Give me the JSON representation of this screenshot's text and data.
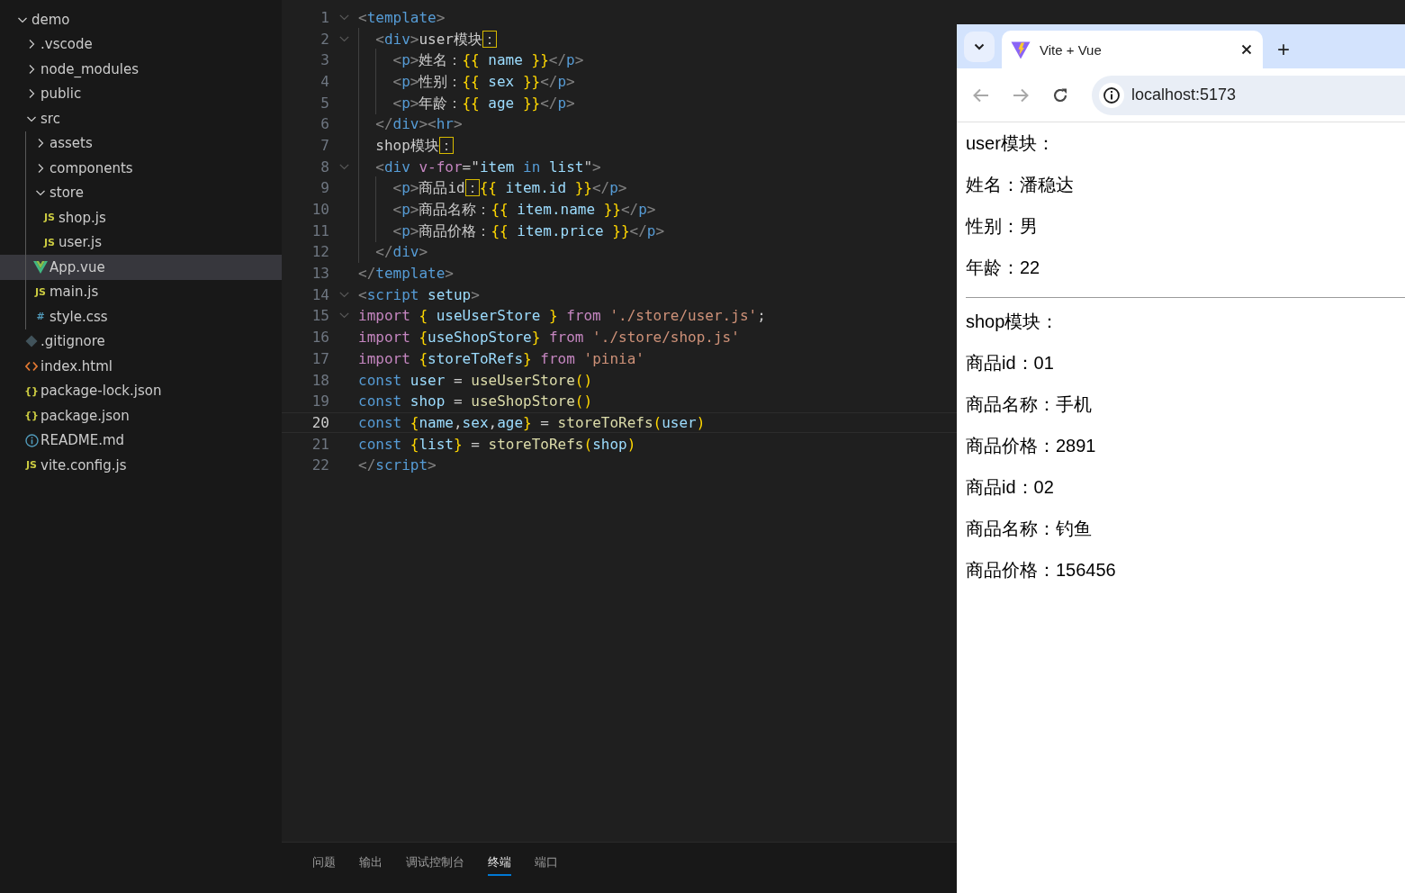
{
  "explorer": {
    "tree": [
      {
        "name": "demo",
        "kind": "folder",
        "expanded": true,
        "selected": false,
        "children": [
          {
            "name": ".vscode",
            "kind": "folder",
            "expanded": false,
            "selected": false
          },
          {
            "name": "node_modules",
            "kind": "folder",
            "expanded": false,
            "selected": false
          },
          {
            "name": "public",
            "kind": "folder",
            "expanded": false,
            "selected": false
          },
          {
            "name": "src",
            "kind": "folder",
            "expanded": true,
            "selected": false,
            "children": [
              {
                "name": "assets",
                "kind": "folder",
                "expanded": false,
                "selected": false
              },
              {
                "name": "components",
                "kind": "folder",
                "expanded": false,
                "selected": false
              },
              {
                "name": "store",
                "kind": "folder",
                "expanded": true,
                "selected": false,
                "children": [
                  {
                    "name": "shop.js",
                    "kind": "js",
                    "icon_text": "JS",
                    "selected": false
                  },
                  {
                    "name": "user.js",
                    "kind": "js",
                    "icon_text": "JS",
                    "selected": false
                  }
                ]
              },
              {
                "name": "App.vue",
                "kind": "vue",
                "selected": true
              },
              {
                "name": "main.js",
                "kind": "js",
                "icon_text": "JS",
                "selected": false
              },
              {
                "name": "style.css",
                "kind": "css",
                "icon_text": "#",
                "selected": false
              }
            ]
          },
          {
            "name": ".gitignore",
            "kind": "git",
            "selected": false
          },
          {
            "name": "index.html",
            "kind": "html",
            "selected": false
          },
          {
            "name": "package-lock.json",
            "kind": "json",
            "icon_text": "{}",
            "selected": false
          },
          {
            "name": "package.json",
            "kind": "json",
            "icon_text": "{}",
            "selected": false
          },
          {
            "name": "README.md",
            "kind": "info",
            "selected": false
          },
          {
            "name": "vite.config.js",
            "kind": "js",
            "icon_text": "JS",
            "selected": false
          }
        ]
      }
    ]
  },
  "editor": {
    "lines": [
      {
        "number": "1",
        "fold": true,
        "active": false,
        "tokens": [
          {
            "kind": "punct",
            "text": "<"
          },
          {
            "kind": "tag",
            "text": "template"
          },
          {
            "kind": "punct",
            "text": ">"
          }
        ]
      },
      {
        "number": "2",
        "fold": true,
        "active": false,
        "tokens": [
          {
            "kind": "punct",
            "text": "  <"
          },
          {
            "kind": "tag",
            "text": "div"
          },
          {
            "kind": "punct",
            "text": ">"
          },
          {
            "kind": "text",
            "text": "user模块"
          },
          {
            "kind": "boxed",
            "text": "："
          }
        ]
      },
      {
        "number": "3",
        "fold": false,
        "active": false,
        "tokens": [
          {
            "kind": "punct",
            "text": "    <"
          },
          {
            "kind": "tag",
            "text": "p"
          },
          {
            "kind": "punct",
            "text": ">"
          },
          {
            "kind": "text",
            "text": "姓名："
          },
          {
            "kind": "brace",
            "text": "{{"
          },
          {
            "kind": "variable",
            "text": " name "
          },
          {
            "kind": "brace",
            "text": "}}"
          },
          {
            "kind": "punct",
            "text": "</"
          },
          {
            "kind": "tag",
            "text": "p"
          },
          {
            "kind": "punct",
            "text": ">"
          }
        ]
      },
      {
        "number": "4",
        "fold": false,
        "active": false,
        "tokens": [
          {
            "kind": "punct",
            "text": "    <"
          },
          {
            "kind": "tag",
            "text": "p"
          },
          {
            "kind": "punct",
            "text": ">"
          },
          {
            "kind": "text",
            "text": "性别："
          },
          {
            "kind": "brace",
            "text": "{{"
          },
          {
            "kind": "variable",
            "text": " sex "
          },
          {
            "kind": "brace",
            "text": "}}"
          },
          {
            "kind": "punct",
            "text": "</"
          },
          {
            "kind": "tag",
            "text": "p"
          },
          {
            "kind": "punct",
            "text": ">"
          }
        ]
      },
      {
        "number": "5",
        "fold": false,
        "active": false,
        "tokens": [
          {
            "kind": "punct",
            "text": "    <"
          },
          {
            "kind": "tag",
            "text": "p"
          },
          {
            "kind": "punct",
            "text": ">"
          },
          {
            "kind": "text",
            "text": "年龄："
          },
          {
            "kind": "brace",
            "text": "{{"
          },
          {
            "kind": "variable",
            "text": " age "
          },
          {
            "kind": "brace",
            "text": "}}"
          },
          {
            "kind": "punct",
            "text": "</"
          },
          {
            "kind": "tag",
            "text": "p"
          },
          {
            "kind": "punct",
            "text": ">"
          }
        ]
      },
      {
        "number": "6",
        "fold": false,
        "active": false,
        "tokens": [
          {
            "kind": "punct",
            "text": "  </"
          },
          {
            "kind": "tag",
            "text": "div"
          },
          {
            "kind": "punct",
            "text": "><"
          },
          {
            "kind": "tag",
            "text": "hr"
          },
          {
            "kind": "punct",
            "text": ">"
          }
        ]
      },
      {
        "number": "7",
        "fold": false,
        "active": false,
        "tokens": [
          {
            "kind": "text",
            "text": "  shop模块"
          },
          {
            "kind": "boxed",
            "text": "："
          }
        ]
      },
      {
        "number": "8",
        "fold": true,
        "active": false,
        "tokens": [
          {
            "kind": "punct",
            "text": "  <"
          },
          {
            "kind": "tag",
            "text": "div"
          },
          {
            "kind": "keyword",
            "text": " v-for"
          },
          {
            "kind": "text",
            "text": "=\""
          },
          {
            "kind": "variable",
            "text": "item"
          },
          {
            "kind": "storage",
            "text": " in "
          },
          {
            "kind": "variable",
            "text": "list"
          },
          {
            "kind": "text",
            "text": "\""
          },
          {
            "kind": "punct",
            "text": ">"
          }
        ]
      },
      {
        "number": "9",
        "fold": false,
        "active": false,
        "tokens": [
          {
            "kind": "punct",
            "text": "    <"
          },
          {
            "kind": "tag",
            "text": "p"
          },
          {
            "kind": "punct",
            "text": ">"
          },
          {
            "kind": "text",
            "text": "商品id"
          },
          {
            "kind": "boxed",
            "text": "："
          },
          {
            "kind": "brace",
            "text": "{{"
          },
          {
            "kind": "variable",
            "text": " item.id "
          },
          {
            "kind": "brace",
            "text": "}}"
          },
          {
            "kind": "punct",
            "text": "</"
          },
          {
            "kind": "tag",
            "text": "p"
          },
          {
            "kind": "punct",
            "text": ">"
          }
        ]
      },
      {
        "number": "10",
        "fold": false,
        "active": false,
        "tokens": [
          {
            "kind": "punct",
            "text": "    <"
          },
          {
            "kind": "tag",
            "text": "p"
          },
          {
            "kind": "punct",
            "text": ">"
          },
          {
            "kind": "text",
            "text": "商品名称："
          },
          {
            "kind": "brace",
            "text": "{{"
          },
          {
            "kind": "variable",
            "text": " item.name "
          },
          {
            "kind": "brace",
            "text": "}}"
          },
          {
            "kind": "punct",
            "text": "</"
          },
          {
            "kind": "tag",
            "text": "p"
          },
          {
            "kind": "punct",
            "text": ">"
          }
        ]
      },
      {
        "number": "11",
        "fold": false,
        "active": false,
        "tokens": [
          {
            "kind": "punct",
            "text": "    <"
          },
          {
            "kind": "tag",
            "text": "p"
          },
          {
            "kind": "punct",
            "text": ">"
          },
          {
            "kind": "text",
            "text": "商品价格："
          },
          {
            "kind": "brace",
            "text": "{{"
          },
          {
            "kind": "variable",
            "text": " item.price "
          },
          {
            "kind": "brace",
            "text": "}}"
          },
          {
            "kind": "punct",
            "text": "</"
          },
          {
            "kind": "tag",
            "text": "p"
          },
          {
            "kind": "punct",
            "text": ">"
          }
        ]
      },
      {
        "number": "12",
        "fold": false,
        "active": false,
        "tokens": [
          {
            "kind": "punct",
            "text": "  </"
          },
          {
            "kind": "tag",
            "text": "div"
          },
          {
            "kind": "punct",
            "text": ">"
          }
        ]
      },
      {
        "number": "13",
        "fold": false,
        "active": false,
        "tokens": [
          {
            "kind": "punct",
            "text": "</"
          },
          {
            "kind": "tag",
            "text": "template"
          },
          {
            "kind": "punct",
            "text": ">"
          }
        ]
      },
      {
        "number": "14",
        "fold": true,
        "active": false,
        "tokens": [
          {
            "kind": "punct",
            "text": "<"
          },
          {
            "kind": "tag",
            "text": "script"
          },
          {
            "kind": "variable",
            "text": " setup"
          },
          {
            "kind": "punct",
            "text": ">"
          }
        ]
      },
      {
        "number": "15",
        "fold": true,
        "active": false,
        "tokens": [
          {
            "kind": "keyword",
            "text": "import "
          },
          {
            "kind": "brace",
            "text": "{"
          },
          {
            "kind": "variable",
            "text": " useUserStore "
          },
          {
            "kind": "brace",
            "text": "}"
          },
          {
            "kind": "keyword",
            "text": " from"
          },
          {
            "kind": "string",
            "text": " './store/user.js'"
          },
          {
            "kind": "text",
            "text": ";"
          }
        ]
      },
      {
        "number": "16",
        "fold": false,
        "active": false,
        "tokens": [
          {
            "kind": "keyword",
            "text": "import "
          },
          {
            "kind": "brace",
            "text": "{"
          },
          {
            "kind": "variable",
            "text": "useShopStore"
          },
          {
            "kind": "brace",
            "text": "}"
          },
          {
            "kind": "keyword",
            "text": " from"
          },
          {
            "kind": "string",
            "text": " './store/shop.js'"
          }
        ]
      },
      {
        "number": "17",
        "fold": false,
        "active": false,
        "tokens": [
          {
            "kind": "keyword",
            "text": "import "
          },
          {
            "kind": "brace",
            "text": "{"
          },
          {
            "kind": "variable",
            "text": "storeToRefs"
          },
          {
            "kind": "brace",
            "text": "}"
          },
          {
            "kind": "keyword",
            "text": " from"
          },
          {
            "kind": "string",
            "text": " 'pinia'"
          }
        ]
      },
      {
        "number": "18",
        "fold": false,
        "active": false,
        "tokens": [
          {
            "kind": "storage",
            "text": "const"
          },
          {
            "kind": "variable",
            "text": " user"
          },
          {
            "kind": "text",
            "text": " = "
          },
          {
            "kind": "function",
            "text": "useUserStore"
          },
          {
            "kind": "brace",
            "text": "()"
          }
        ]
      },
      {
        "number": "19",
        "fold": false,
        "active": false,
        "tokens": [
          {
            "kind": "storage",
            "text": "const"
          },
          {
            "kind": "variable",
            "text": " shop"
          },
          {
            "kind": "text",
            "text": " = "
          },
          {
            "kind": "function",
            "text": "useShopStore"
          },
          {
            "kind": "brace",
            "text": "()"
          }
        ]
      },
      {
        "number": "20",
        "fold": false,
        "active": true,
        "tokens": [
          {
            "kind": "storage",
            "text": "const "
          },
          {
            "kind": "brace",
            "text": "{"
          },
          {
            "kind": "variable",
            "text": "name"
          },
          {
            "kind": "text",
            "text": ","
          },
          {
            "kind": "variable",
            "text": "sex"
          },
          {
            "kind": "text",
            "text": ","
          },
          {
            "kind": "variable",
            "text": "age"
          },
          {
            "kind": "brace",
            "text": "}"
          },
          {
            "kind": "text",
            "text": " = "
          },
          {
            "kind": "function",
            "text": "storeToRefs"
          },
          {
            "kind": "brace",
            "text": "("
          },
          {
            "kind": "variable",
            "text": "user"
          },
          {
            "kind": "brace",
            "text": ")"
          }
        ]
      },
      {
        "number": "21",
        "fold": false,
        "active": false,
        "tokens": [
          {
            "kind": "storage",
            "text": "const "
          },
          {
            "kind": "brace",
            "text": "{"
          },
          {
            "kind": "variable",
            "text": "list"
          },
          {
            "kind": "brace",
            "text": "}"
          },
          {
            "kind": "text",
            "text": " = "
          },
          {
            "kind": "function",
            "text": "storeToRefs"
          },
          {
            "kind": "brace",
            "text": "("
          },
          {
            "kind": "variable",
            "text": "shop"
          },
          {
            "kind": "brace",
            "text": ")"
          }
        ]
      },
      {
        "number": "22",
        "fold": false,
        "active": false,
        "tokens": [
          {
            "kind": "punct",
            "text": "</"
          },
          {
            "kind": "tag",
            "text": "script"
          },
          {
            "kind": "punct",
            "text": ">"
          }
        ]
      }
    ]
  },
  "panel": {
    "tabs": [
      {
        "label": "问题",
        "selected": false
      },
      {
        "label": "输出",
        "selected": false
      },
      {
        "label": "调试控制台",
        "selected": false
      },
      {
        "label": "终端",
        "selected": true
      },
      {
        "label": "端口",
        "selected": false
      }
    ]
  },
  "browser": {
    "tab": {
      "title": "Vite + Vue"
    },
    "new_tab": "+",
    "back_disabled": true,
    "forward_disabled": true,
    "address": "localhost:5173",
    "page": [
      {
        "kind": "text",
        "text": "user模块："
      },
      {
        "kind": "text",
        "text": "姓名：潘稳达"
      },
      {
        "kind": "text",
        "text": "性别：男"
      },
      {
        "kind": "text",
        "text": "年龄：22"
      },
      {
        "kind": "rule"
      },
      {
        "kind": "text",
        "text": "shop模块："
      },
      {
        "kind": "text",
        "text": "商品id：01"
      },
      {
        "kind": "text",
        "text": "商品名称：手机"
      },
      {
        "kind": "text",
        "text": "商品价格：2891"
      },
      {
        "kind": "text",
        "text": "商品id：02"
      },
      {
        "kind": "text",
        "text": "商品名称：钓鱼"
      },
      {
        "kind": "text",
        "text": "商品价格：156456"
      }
    ]
  }
}
